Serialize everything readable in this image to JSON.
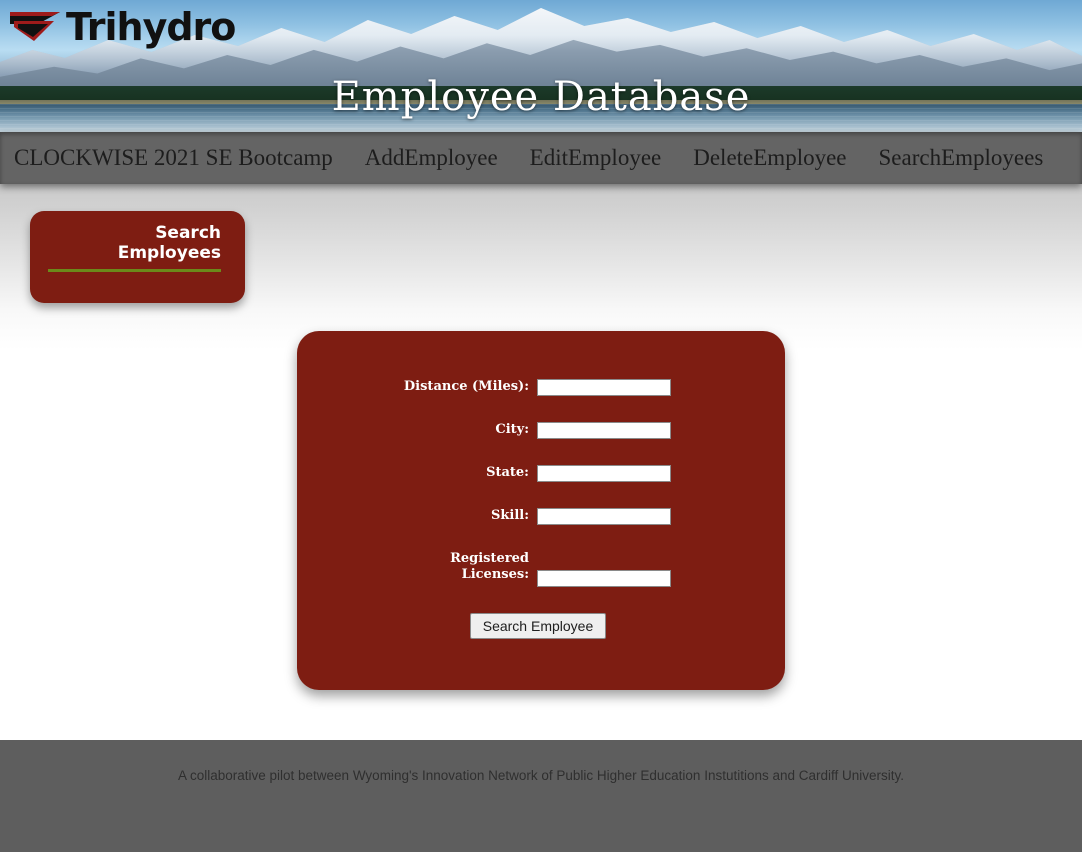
{
  "banner": {
    "logo_text": "Trihydro",
    "logo_mark_icon": "trihydro-arrow-icon",
    "title": "Employee Database"
  },
  "nav": {
    "items": [
      {
        "label": "CLOCKWISE 2021 SE Bootcamp"
      },
      {
        "label": "AddEmployee"
      },
      {
        "label": "EditEmployee"
      },
      {
        "label": "DeleteEmployee"
      },
      {
        "label": "SearchEmployees"
      }
    ]
  },
  "section_card": {
    "title_line1": "Search",
    "title_line2": "Employees"
  },
  "form": {
    "fields": [
      {
        "label": "Distance (Miles):",
        "value": "",
        "placeholder": ""
      },
      {
        "label": "City:",
        "value": "",
        "placeholder": ""
      },
      {
        "label": "State:",
        "value": "",
        "placeholder": ""
      },
      {
        "label": "Skill:",
        "value": "",
        "placeholder": ""
      },
      {
        "label_line1": "Registered",
        "label_line2": "Licenses:",
        "value": "",
        "placeholder": ""
      }
    ],
    "submit_label": "Search Employee"
  },
  "footer": {
    "text": "A collaborative pilot between Wyoming's Innovation Network of Public Higher Education Instutitions and Cardiff University."
  },
  "colors": {
    "card_red": "#7e1d12",
    "nav_gray": "#646464",
    "footer_gray": "#5e5e5e",
    "rule_green": "#6b8a1a"
  }
}
